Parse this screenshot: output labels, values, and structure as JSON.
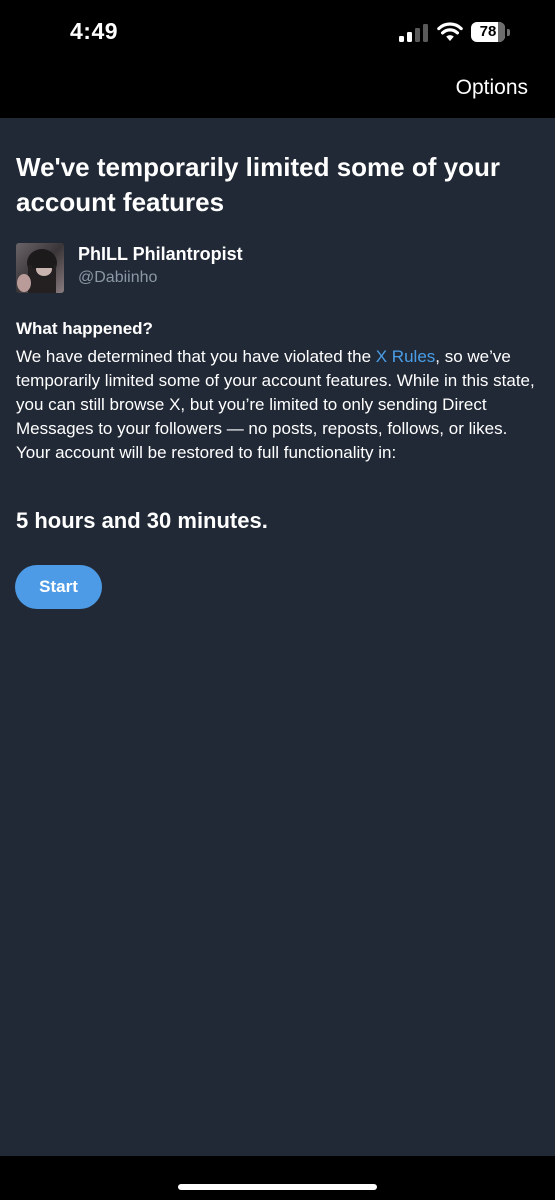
{
  "status_bar": {
    "time": "4:49",
    "battery_level": 78,
    "icons": [
      "signal-icon",
      "wifi-icon",
      "battery-icon"
    ]
  },
  "nav": {
    "options_label": "Options"
  },
  "main": {
    "title": "We've temporarily limited some of your account features",
    "profile": {
      "display_name": "PhILL Philantropist",
      "username": "@Dabiinho"
    },
    "section_heading": "What happened?",
    "explanation_before_link": "We have determined that you have violated the ",
    "rules_link": "X Rules",
    "explanation_after_link": ", so we’ve temporarily limited some of your account features. While in this state, you can still browse X, but you’re limited to only sending Direct Messages to your followers — no posts, reposts, follows, or likes. Your account will be restored to full functionality in:",
    "countdown": "5 hours and 30 minutes.",
    "start_label": "Start"
  },
  "colors": {
    "background": "#212936",
    "bars": "#000000",
    "link": "#4a9ee8",
    "button": "#4d9be6",
    "secondary_text": "#8b98a5"
  }
}
